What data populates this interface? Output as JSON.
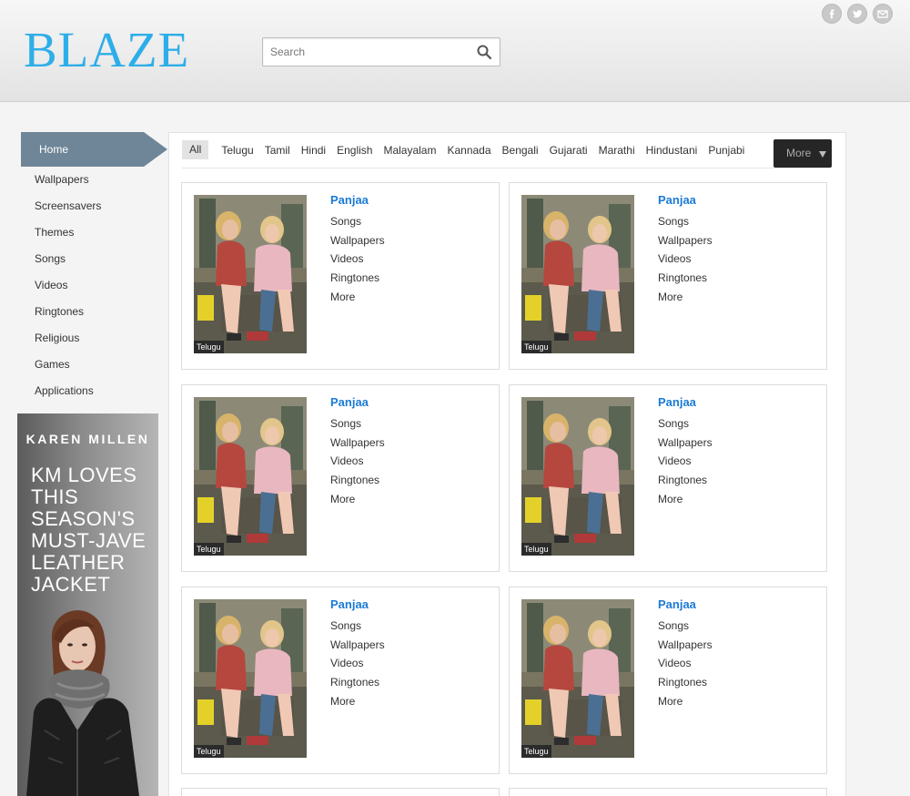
{
  "header": {
    "logo": "BLAZE",
    "search_placeholder": "Search",
    "social": [
      "facebook-icon",
      "twitter-icon",
      "email-icon"
    ]
  },
  "sidebar": {
    "home": "Home",
    "items": [
      "Wallpapers",
      "Screensavers",
      "Themes",
      "Songs",
      "Videos",
      "Ringtones",
      "Religious",
      "Games",
      "Applications"
    ]
  },
  "ad": {
    "brand": "KAREN MILLEN",
    "lines": [
      "KM LOVES",
      "THIS",
      "SEASON'S",
      "MUST-JAVE",
      "LEATHER",
      "JACKET"
    ]
  },
  "filters": {
    "items": [
      "All",
      "Telugu",
      "Tamil",
      "Hindi",
      "English",
      "Malayalam",
      "Kannada",
      "Bengali",
      "Gujarati",
      "Marathi",
      "Hindustani",
      "Punjabi"
    ],
    "active": "All",
    "more_label": "More"
  },
  "cards": [
    {
      "title": "Panjaa",
      "tag": "Telugu",
      "links": [
        "Songs",
        "Wallpapers",
        "Videos",
        "Ringtones",
        "More"
      ]
    },
    {
      "title": "Panjaa",
      "tag": "Telugu",
      "links": [
        "Songs",
        "Wallpapers",
        "Videos",
        "Ringtones",
        "More"
      ]
    },
    {
      "title": "Panjaa",
      "tag": "Telugu",
      "links": [
        "Songs",
        "Wallpapers",
        "Videos",
        "Ringtones",
        "More"
      ]
    },
    {
      "title": "Panjaa",
      "tag": "Telugu",
      "links": [
        "Songs",
        "Wallpapers",
        "Videos",
        "Ringtones",
        "More"
      ]
    },
    {
      "title": "Panjaa",
      "tag": "Telugu",
      "links": [
        "Songs",
        "Wallpapers",
        "Videos",
        "Ringtones",
        "More"
      ]
    },
    {
      "title": "Panjaa",
      "tag": "Telugu",
      "links": [
        "Songs",
        "Wallpapers",
        "Videos",
        "Ringtones",
        "More"
      ]
    }
  ],
  "colors": {
    "logo": "#2eaee8",
    "nav_active": "#6f8698",
    "card_title": "#1b7bd6",
    "more_button": "#262626"
  }
}
